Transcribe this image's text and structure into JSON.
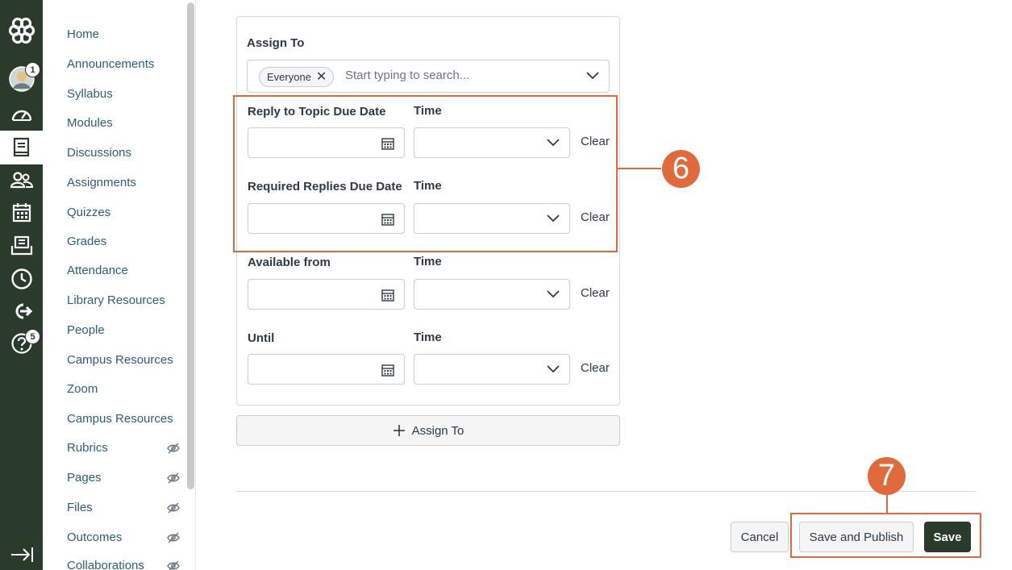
{
  "global_nav": {
    "items": [
      {
        "name": "logo-icon"
      },
      {
        "name": "account-avatar",
        "badge": "1"
      },
      {
        "name": "dashboard-icon"
      },
      {
        "name": "courses-icon"
      },
      {
        "name": "groups-icon"
      },
      {
        "name": "calendar-icon"
      },
      {
        "name": "inbox-icon"
      },
      {
        "name": "history-icon"
      },
      {
        "name": "commons-icon"
      },
      {
        "name": "help-icon",
        "badge": "5"
      },
      {
        "name": "collapse-nav-icon"
      }
    ]
  },
  "course_nav": {
    "items": [
      {
        "label": "Home",
        "hidden": false
      },
      {
        "label": "Announcements",
        "hidden": false
      },
      {
        "label": "Syllabus",
        "hidden": false
      },
      {
        "label": "Modules",
        "hidden": false
      },
      {
        "label": "Discussions",
        "hidden": false
      },
      {
        "label": "Assignments",
        "hidden": false
      },
      {
        "label": "Quizzes",
        "hidden": false
      },
      {
        "label": "Grades",
        "hidden": false
      },
      {
        "label": "Attendance",
        "hidden": false
      },
      {
        "label": "Library Resources",
        "hidden": false
      },
      {
        "label": "People",
        "hidden": false
      },
      {
        "label": "Campus Resources",
        "hidden": false
      },
      {
        "label": "Zoom",
        "hidden": false
      },
      {
        "label": "Campus Resources",
        "hidden": false
      },
      {
        "label": "Rubrics",
        "hidden": true
      },
      {
        "label": "Pages",
        "hidden": true
      },
      {
        "label": "Files",
        "hidden": true
      },
      {
        "label": "Outcomes",
        "hidden": true
      },
      {
        "label": "Collaborations",
        "hidden": true
      }
    ]
  },
  "assign": {
    "label": "Assign To",
    "tag": "Everyone",
    "placeholder": "Start typing to search...",
    "rows": [
      {
        "date_label": "Reply to Topic Due Date",
        "time_label": "Time",
        "clear": "Clear"
      },
      {
        "date_label": "Required Replies Due Date",
        "time_label": "Time",
        "clear": "Clear"
      },
      {
        "date_label": "Available from",
        "time_label": "Time",
        "clear": "Clear"
      },
      {
        "date_label": "Until",
        "time_label": "Time",
        "clear": "Clear"
      }
    ],
    "add_button": "Assign To"
  },
  "footer": {
    "cancel": "Cancel",
    "save_publish": "Save and Publish",
    "save": "Save"
  },
  "callouts": {
    "step6": "6",
    "step7": "7"
  },
  "colors": {
    "nav_bg": "#2a3a2b",
    "link": "#2b5e7e",
    "highlight": "#e06a3c"
  }
}
